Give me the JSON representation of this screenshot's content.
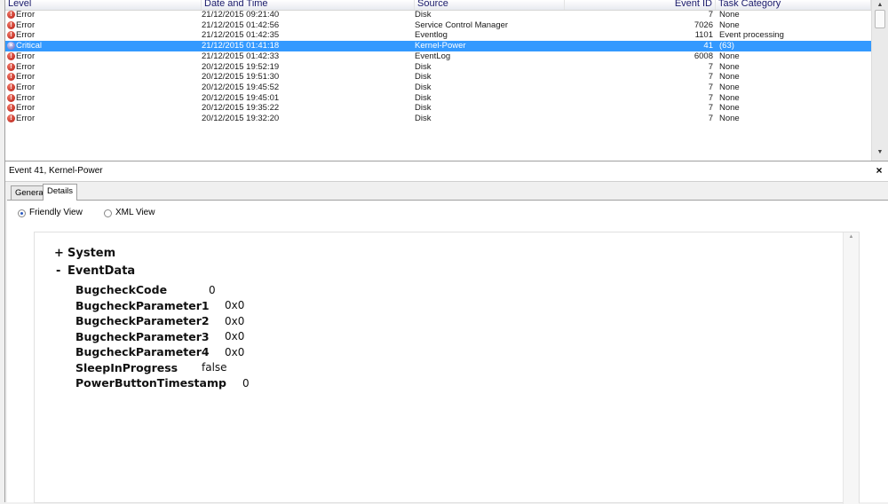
{
  "event_list": {
    "columns": {
      "level": "Level",
      "datetime": "Date and Time",
      "source": "Source",
      "event_id": "Event ID",
      "task_category": "Task Category"
    },
    "rows": [
      {
        "level": "Error",
        "datetime": "21/12/2015 09:21:40",
        "source": "Disk",
        "event_id": "7",
        "task_category": "None",
        "icon": "error-icon"
      },
      {
        "level": "Error",
        "datetime": "21/12/2015 01:42:56",
        "source": "Service Control Manager",
        "event_id": "7026",
        "task_category": "None",
        "icon": "error-icon"
      },
      {
        "level": "Error",
        "datetime": "21/12/2015 01:42:35",
        "source": "Eventlog",
        "event_id": "1101",
        "task_category": "Event processing",
        "icon": "error-icon"
      },
      {
        "level": "Critical",
        "datetime": "21/12/2015 01:41:18",
        "source": "Kernel-Power",
        "event_id": "41",
        "task_category": "(63)",
        "icon": "critical-icon",
        "selected": true
      },
      {
        "level": "Error",
        "datetime": "21/12/2015 01:42:33",
        "source": "EventLog",
        "event_id": "6008",
        "task_category": "None",
        "icon": "error-icon"
      },
      {
        "level": "Error",
        "datetime": "20/12/2015 19:52:19",
        "source": "Disk",
        "event_id": "7",
        "task_category": "None",
        "icon": "error-icon"
      },
      {
        "level": "Error",
        "datetime": "20/12/2015 19:51:30",
        "source": "Disk",
        "event_id": "7",
        "task_category": "None",
        "icon": "error-icon"
      },
      {
        "level": "Error",
        "datetime": "20/12/2015 19:45:52",
        "source": "Disk",
        "event_id": "7",
        "task_category": "None",
        "icon": "error-icon"
      },
      {
        "level": "Error",
        "datetime": "20/12/2015 19:45:01",
        "source": "Disk",
        "event_id": "7",
        "task_category": "None",
        "icon": "error-icon"
      },
      {
        "level": "Error",
        "datetime": "20/12/2015 19:35:22",
        "source": "Disk",
        "event_id": "7",
        "task_category": "None",
        "icon": "error-icon"
      },
      {
        "level": "Error",
        "datetime": "20/12/2015 19:32:20",
        "source": "Disk",
        "event_id": "7",
        "task_category": "None",
        "icon": "error-icon"
      }
    ],
    "colors": {
      "selected_row": "#3399ff",
      "error_icon": "#c0392b",
      "critical_icon": "#6a6ab4"
    }
  },
  "detail": {
    "title": "Event 41, Kernel-Power",
    "close_symbol": "×",
    "tabs": [
      {
        "label": "General",
        "active": false
      },
      {
        "label": "Details",
        "active": true
      }
    ],
    "view_options": [
      {
        "label": "Friendly View",
        "checked": true
      },
      {
        "label": "XML View",
        "checked": false
      }
    ],
    "tree": {
      "system": {
        "sign": "+",
        "label": "System"
      },
      "eventdata": {
        "sign": "-",
        "label": "EventData"
      },
      "fields": [
        {
          "key": "BugcheckCode",
          "value": "0"
        },
        {
          "key": "BugcheckParameter1",
          "value": "0x0"
        },
        {
          "key": "BugcheckParameter2",
          "value": "0x0"
        },
        {
          "key": "BugcheckParameter3",
          "value": "0x0"
        },
        {
          "key": "BugcheckParameter4",
          "value": "0x0"
        },
        {
          "key": "SleepInProgress",
          "value": "false"
        },
        {
          "key": "PowerButtonTimestamp",
          "value": "0"
        }
      ]
    }
  }
}
